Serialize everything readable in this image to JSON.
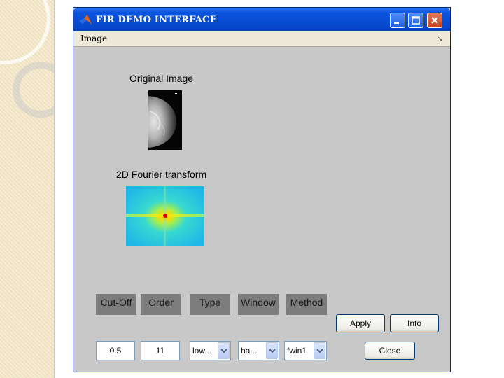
{
  "window": {
    "title": "FIR DEMO INTERFACE"
  },
  "menu": {
    "items": [
      "Image"
    ],
    "dock_glyph": "↘"
  },
  "panels": {
    "original_label": "Original Image",
    "fft_label": "2D Fourier transform"
  },
  "controls": {
    "headers": [
      "Cut-Off",
      "Order",
      "Type",
      "Window",
      "Method"
    ],
    "cutoff_value": "0.5",
    "order_value": "11",
    "type_value": "low...",
    "window_value": "ha...",
    "method_value": "fwin1"
  },
  "buttons": {
    "apply": "Apply",
    "info": "Info",
    "close": "Close"
  },
  "icons": {
    "app": "matlab-logo-icon",
    "minimize": "minimize-icon",
    "maximize": "maximize-icon",
    "close": "close-icon",
    "dropdown": "chevron-down-icon"
  },
  "colors": {
    "title_bar": "#0b55de",
    "content_bg": "#c8c8c8",
    "header_bg": "#7d7d7d",
    "close_btn": "#c5401d"
  }
}
